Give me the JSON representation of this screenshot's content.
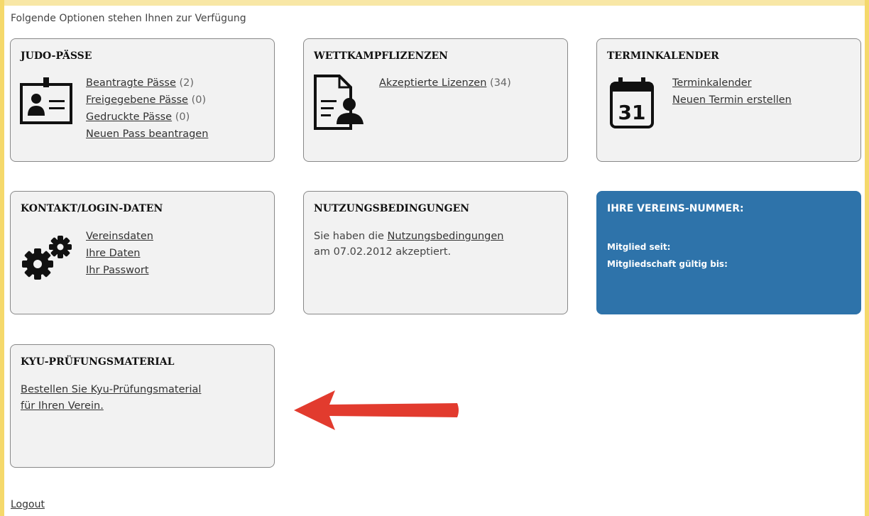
{
  "intro": "Folgende Optionen stehen Ihnen zur Verfügung",
  "judo": {
    "title": "JUDO-PÄSSE",
    "icon": "id-card-icon",
    "items": [
      {
        "label": "Beantragte Pässe",
        "count": "(2)"
      },
      {
        "label": "Freigegebene Pässe",
        "count": "(0)"
      },
      {
        "label": "Gedruckte Pässe",
        "count": "(0)"
      },
      {
        "label": "Neuen Pass beantragen",
        "count": ""
      }
    ]
  },
  "wettkampf": {
    "title": "WETTKAMPFLIZENZEN",
    "icon": "license-document-icon",
    "items": [
      {
        "label": "Akzeptierte Lizenzen",
        "count": "(34)"
      }
    ]
  },
  "termin": {
    "title": "TERMINKALENDER",
    "icon": "calendar-icon",
    "calendar_day": "31",
    "items": [
      {
        "label": "Terminkalender"
      },
      {
        "label": "Neuen Termin erstellen"
      }
    ]
  },
  "kontakt": {
    "title": "KONTAKT/LOGIN-DATEN",
    "icon": "gears-icon",
    "items": [
      {
        "label": "Vereinsdaten"
      },
      {
        "label": "Ihre Daten"
      },
      {
        "label": "Ihr Passwort"
      }
    ]
  },
  "nutzung": {
    "title": "NUTZUNGSBEDINGUNGEN",
    "text_before": "Sie haben die",
    "link": "Nutzungsbedingungen",
    "text_after": "am 07.02.2012 akzeptiert."
  },
  "verein": {
    "title": "IHRE VEREINS-NUMMER:",
    "member_since": "Mitglied seit:",
    "valid_until": "Mitgliedschaft gültig bis:"
  },
  "kyu": {
    "title": "KYU-PRÜFUNGSMATERIAL",
    "link_line1": "Bestellen Sie Kyu-Prüfungsmaterial",
    "link_line2": "für Ihren Verein."
  },
  "logout": "Logout",
  "colors": {
    "blue_card": "#2e73aa",
    "arrow": "#e23b2e",
    "background_edge": "#f5d96b"
  }
}
